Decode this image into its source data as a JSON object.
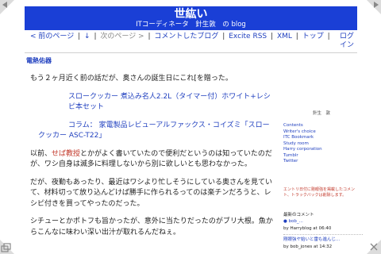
{
  "header": {
    "title": "世紘い",
    "subtitle": "ITコーディネータ　針生敦　の blog"
  },
  "nav": {
    "prev": "< 前のページ",
    "sep1": "|",
    "down": "↓",
    "sep2": "|",
    "next": "次のページ >",
    "sep3": "|",
    "commented": "コメントしたブログ",
    "sep4": "|",
    "rss": "Excite RSS",
    "sep5": "|",
    "xml": "XML",
    "sep6": "|",
    "top": "トップ",
    "sep7": "|",
    "login_line1": "ログ",
    "login_line2": "イン"
  },
  "category": "電熱佑器",
  "post": {
    "p1": "もう２ヶ月近く前の話だが、奥さんの誕生日にこれ[を贈った。",
    "item1": "スロークッカー 煮込み名人2.2L（タイマー付）ホワイト+レシピ本セット",
    "item2_a": "コラム：",
    "item2_b": "家電製品レビューアルファックス・コイズミ「スロークッカー ASC-T22」",
    "p2_a": "以前、",
    "p2_link": "せば教授",
    "p2_b": "とかがよく書いていたので便利だというのは知っていたのだが、ワシ自身は滅多に料理しないから別に欲しいとも思わなかった。",
    "p3": "だが、夜勤もあったり、最近はワシより忙しそうにしている奥さんを見ていて、材料切って放り込んどけば勝手に作られるってのは楽チンだろうと、レシピ付きを買ってやったのだった。",
    "p4": "シチューとかポトフも旨かったが、意外に当たりだったのがブリ大根。魚からこんなに味わい深い出汁が取れるんだねぇ。"
  },
  "sidebar": {
    "name": "針生　敦",
    "links": [
      "Contents",
      "Writer's choice",
      "ITC Bookmark",
      "Study room",
      "Harry corporation",
      "Tumblr",
      "Twitter"
    ],
    "note": "エントリ日付に剛眼強を掲載したコメント、トラックバックは削除します。",
    "recent_heading": "最新のコメント",
    "comments": [
      {
        "title": "● bob_...",
        "meta": "by Harryblog at 06:40"
      },
      {
        "title": "剛眼強ヤ始いと雷も進んじ...",
        "meta": "by bob_jones at 14:32"
      }
    ]
  },
  "icons": {
    "top_left": "arrow-left-icon",
    "top_right": "arrow-right-icon",
    "bottom_left": "window-icon",
    "bottom_right": "fullscreen-icon"
  },
  "colors": {
    "header_bg": "#1a3fd6",
    "link": "#1f3fbf",
    "accent_red": "#c2382a"
  }
}
